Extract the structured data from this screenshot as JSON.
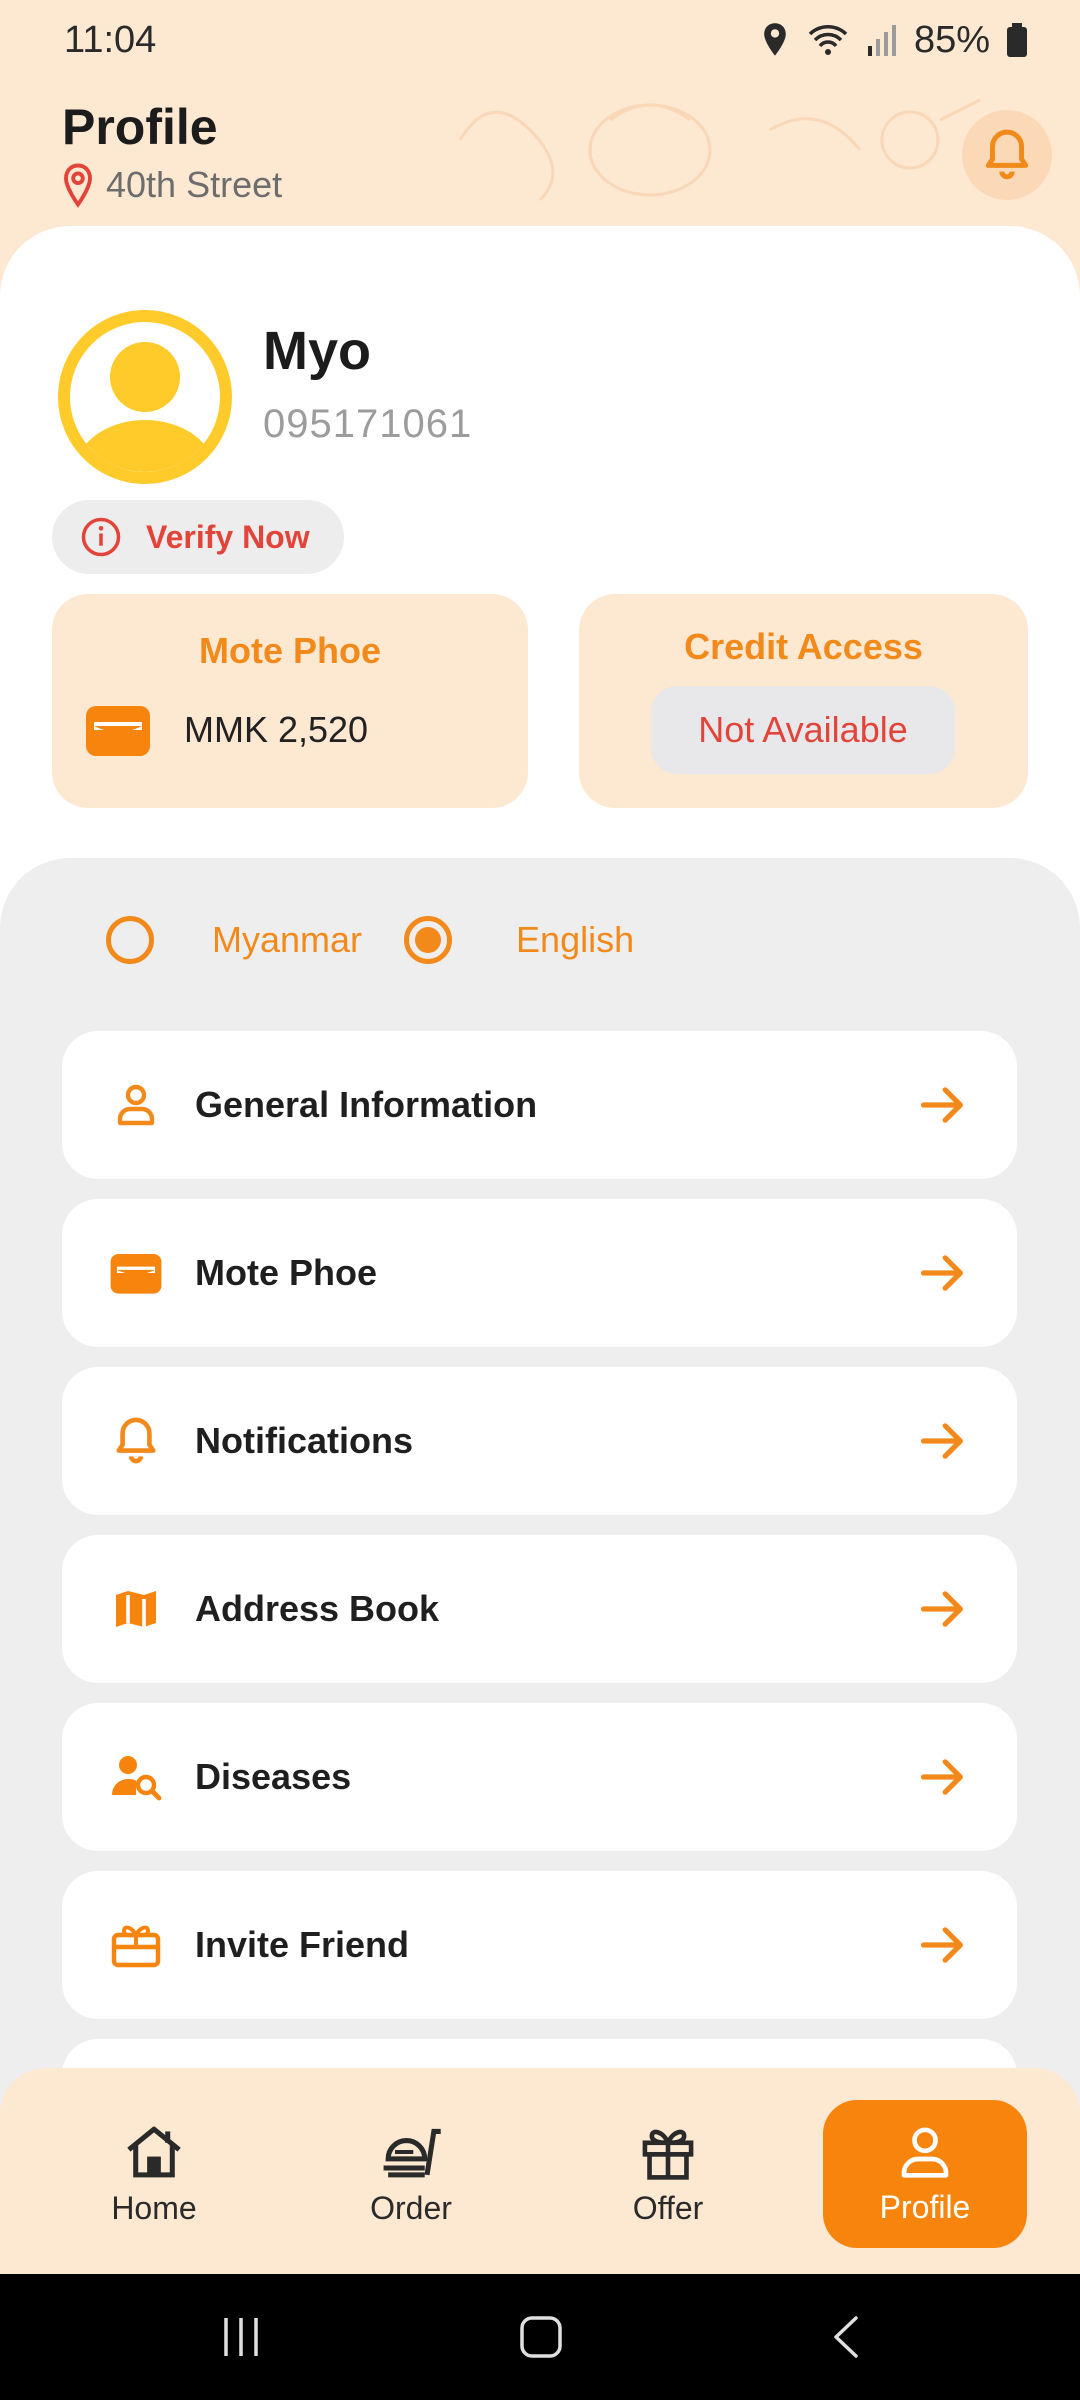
{
  "status_bar": {
    "time": "11:04",
    "battery": "85%"
  },
  "header": {
    "title": "Profile",
    "location": "40th Street"
  },
  "user": {
    "name": "Myo",
    "phone": "095171061",
    "verify_label": "Verify Now"
  },
  "wallet": {
    "title": "Mote Phoe",
    "balance": "MMK 2,520"
  },
  "credit": {
    "title": "Credit Access",
    "status": "Not Available"
  },
  "language": {
    "options": [
      "Myanmar",
      "English"
    ],
    "selected": "English"
  },
  "menu": {
    "items": [
      {
        "label": "General Information",
        "icon": "person-icon"
      },
      {
        "label": "Mote Phoe",
        "icon": "wallet-icon"
      },
      {
        "label": "Notifications",
        "icon": "bell-icon"
      },
      {
        "label": "Address Book",
        "icon": "map-icon"
      },
      {
        "label": "Diseases",
        "icon": "person-search-icon"
      },
      {
        "label": "Invite Friend",
        "icon": "gift-card-icon"
      }
    ]
  },
  "bottom_nav": {
    "items": [
      {
        "label": "Home",
        "icon": "home-icon"
      },
      {
        "label": "Order",
        "icon": "order-icon"
      },
      {
        "label": "Offer",
        "icon": "gift-icon"
      },
      {
        "label": "Profile",
        "icon": "person-icon"
      }
    ],
    "active": "Profile"
  },
  "colors": {
    "accent": "#F28A1B",
    "accent_dark": "#F7850D",
    "background": "#FDE8D2",
    "panel": "#EEEEEE",
    "warning": "#E2443A",
    "avatar": "#FFCB2B"
  }
}
